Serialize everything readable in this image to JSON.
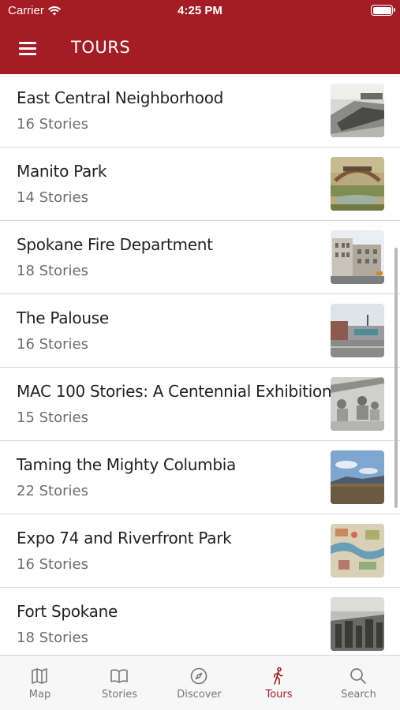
{
  "status_bar": {
    "carrier": "Carrier",
    "time": "4:25 PM"
  },
  "header": {
    "title": "TOURS",
    "menu_icon": "hamburger-menu-icon"
  },
  "colors": {
    "brand": "#a41c24",
    "tab_inactive": "#777777",
    "tab_active": "#a41c24"
  },
  "tours": [
    {
      "title": "East Central Neighborhood",
      "count": "16 Stories"
    },
    {
      "title": "Manito Park",
      "count": "14 Stories"
    },
    {
      "title": "Spokane Fire Department",
      "count": "18 Stories"
    },
    {
      "title": "The Palouse",
      "count": "16 Stories"
    },
    {
      "title": "MAC 100 Stories: A Centennial Exhibition",
      "count": "15 Stories"
    },
    {
      "title": "Taming the Mighty Columbia",
      "count": "22 Stories"
    },
    {
      "title": "Expo 74 and Riverfront Park",
      "count": "16 Stories"
    },
    {
      "title": "Fort Spokane",
      "count": "18 Stories"
    }
  ],
  "tabbar": {
    "active": "Tours",
    "tabs": [
      {
        "label": "Map",
        "icon": "map-icon"
      },
      {
        "label": "Stories",
        "icon": "book-icon"
      },
      {
        "label": "Discover",
        "icon": "compass-icon"
      },
      {
        "label": "Tours",
        "icon": "walking-person-icon"
      },
      {
        "label": "Search",
        "icon": "search-icon"
      }
    ]
  }
}
